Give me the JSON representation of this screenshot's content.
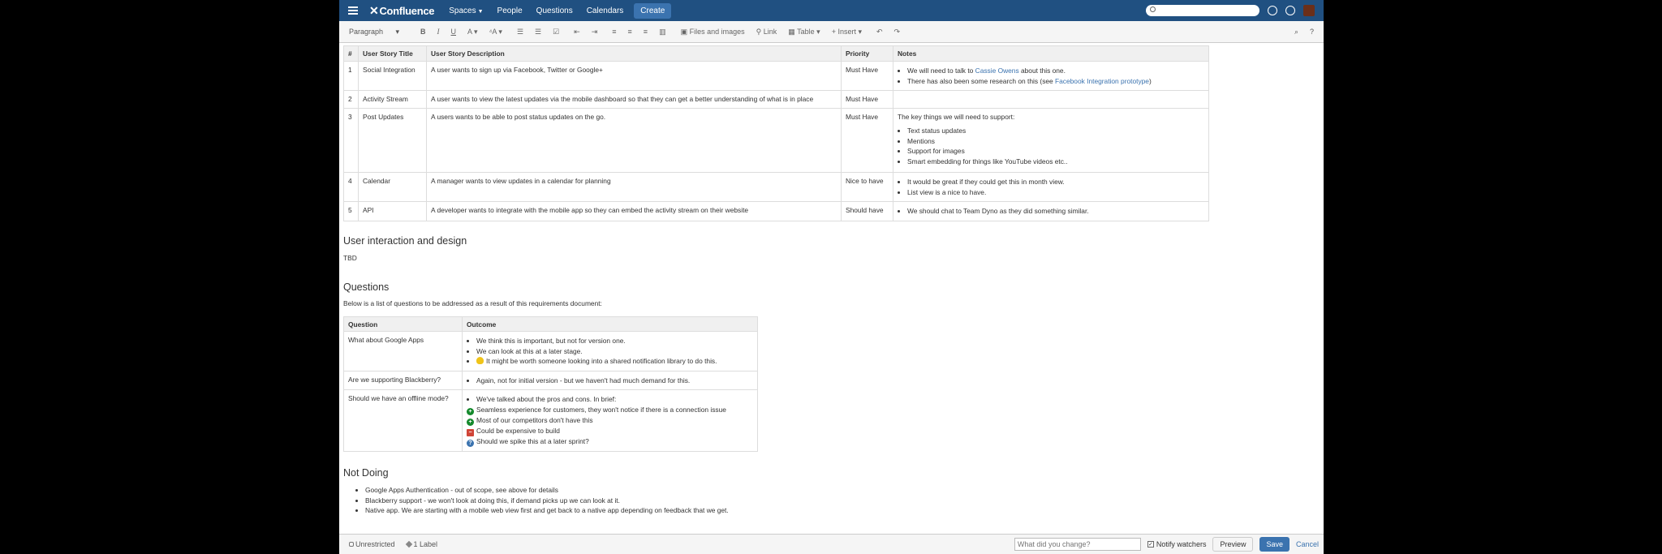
{
  "nav": {
    "logo": "Confluence",
    "items": [
      {
        "label": "Spaces",
        "caret": true
      },
      {
        "label": "People",
        "caret": false
      },
      {
        "label": "Questions",
        "caret": false
      },
      {
        "label": "Calendars",
        "caret": false
      }
    ],
    "create": "Create"
  },
  "toolbar": {
    "paragraph": "Paragraph",
    "files": "Files and images",
    "link": "Link",
    "table": "Table",
    "insert": "+ Insert"
  },
  "requirements": {
    "headers": [
      "#",
      "User Story Title",
      "User Story Description",
      "Priority",
      "Notes"
    ],
    "rows": [
      {
        "num": "1",
        "title": "Social Integration",
        "desc": "A user wants to sign up via Facebook, Twitter or Google+",
        "priority": "Must Have"
      },
      {
        "num": "2",
        "title": "Activity Stream",
        "desc": "A user wants to view the latest updates via the mobile dashboard so that they can get a better understanding of what is in place",
        "priority": "Must Have"
      },
      {
        "num": "3",
        "title": "Post Updates",
        "desc": "A users wants to be able to post status updates on the go.",
        "priority": "Must Have"
      },
      {
        "num": "4",
        "title": "Calendar",
        "desc": "A manager wants to view updates in a calendar for planning",
        "priority": "Nice to have"
      },
      {
        "num": "5",
        "title": "API",
        "desc": "A developer wants to integrate with the mobile app so they can embed the activity stream on their website",
        "priority": "Should have"
      }
    ],
    "notes": {
      "r1_a_pre": "We will need to talk to ",
      "r1_a_link": "Cassie Owens",
      "r1_a_post": " about this one.",
      "r1_b_pre": "There has also been some research on this (see ",
      "r1_b_link": "Facebook Integration prototype",
      "r1_b_post": ")",
      "r3_intro": "The key things we will need to support:",
      "r3_items": [
        "Text status updates",
        "Mentions",
        "Support for images",
        "Smart embedding for things like YouTube videos etc.."
      ],
      "r4_items": [
        "It would be great if they could get this in month view.",
        "List view is a nice to have."
      ],
      "r5_items": [
        "We should chat to Team Dyno as they did something similar."
      ]
    }
  },
  "design": {
    "heading": "User interaction and design",
    "body": "TBD"
  },
  "questions": {
    "heading": "Questions",
    "intro": "Below is a list of questions to be addressed as a result of this requirements document:",
    "headers": [
      "Question",
      "Outcome"
    ],
    "q1": "What about Google Apps",
    "q1_items": [
      "We think this is important, but not for version one.",
      "We can look at this at a later stage.",
      "It might be worth someone looking into a shared notification library to do this."
    ],
    "q2": "Are we supporting Blackberry?",
    "q2_items": [
      "Again, not for initial version - but we haven't had much demand for this."
    ],
    "q3": "Should we have an offline mode?",
    "q3_intro": "We've talked about the pros and cons. In brief:",
    "q3_items": [
      "Seamless experience for customers, they won't notice if there is a connection issue",
      "Most of our competitors don't have this",
      "Could be expensive to build",
      "Should we spike this at a later sprint?"
    ]
  },
  "notdoing": {
    "heading": "Not Doing",
    "items": [
      "Google Apps Authentication - out of scope, see above for details",
      "Blackberry support - we won't look at doing this, if demand picks up we can look at it.",
      "Native app. We are starting with a mobile web view first and get back to a native app depending on feedback that we get."
    ]
  },
  "footer": {
    "restrictions": "Unrestricted",
    "labels": "1 Label",
    "change_placeholder": "What did you change?",
    "notify": "Notify watchers",
    "preview": "Preview",
    "save": "Save",
    "cancel": "Cancel"
  }
}
